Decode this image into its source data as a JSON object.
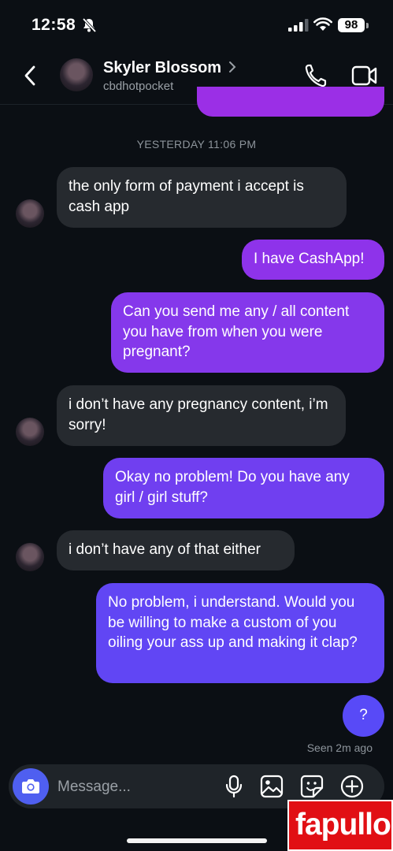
{
  "status_bar": {
    "time": "12:58",
    "battery": "98"
  },
  "header": {
    "contact_name": "Skyler Blossom",
    "username": "cbdhotpocket"
  },
  "timestamp": "YESTERDAY 11:06 PM",
  "messages": [
    {
      "from": "them",
      "text": "the only form of payment i accept is cash app"
    },
    {
      "from": "me",
      "text": "I have CashApp!"
    },
    {
      "from": "me",
      "text": "Can you send me any / all content you have from when you were pregnant?"
    },
    {
      "from": "them",
      "text": "i don’t have any pregnancy content, i’m sorry!"
    },
    {
      "from": "me",
      "text": "Okay no problem! Do you have any girl / girl stuff?"
    },
    {
      "from": "them",
      "text": "i don’t have any of that either"
    },
    {
      "from": "me",
      "text": "No problem, i understand. Would you be willing to make a custom of you oiling your ass up and making it clap?"
    },
    {
      "from": "me",
      "text": "?"
    }
  ],
  "seen_status": "Seen 2m ago",
  "composer": {
    "placeholder": "Message..."
  },
  "watermark": "fapullo",
  "colors": {
    "background": "#0b0f14",
    "incoming_bubble": "#262a2f",
    "outgoing_top": "#9b2fe6",
    "outgoing_bottom": "#5b4af7",
    "camera_button": "#4f5ff0"
  },
  "icons": [
    "bell-slash-icon",
    "signal-icon",
    "wifi-icon",
    "battery-icon",
    "back-chevron-icon",
    "chevron-right-icon",
    "phone-icon",
    "video-icon",
    "camera-icon",
    "microphone-icon",
    "gallery-icon",
    "sticker-icon",
    "plus-circle-icon"
  ]
}
